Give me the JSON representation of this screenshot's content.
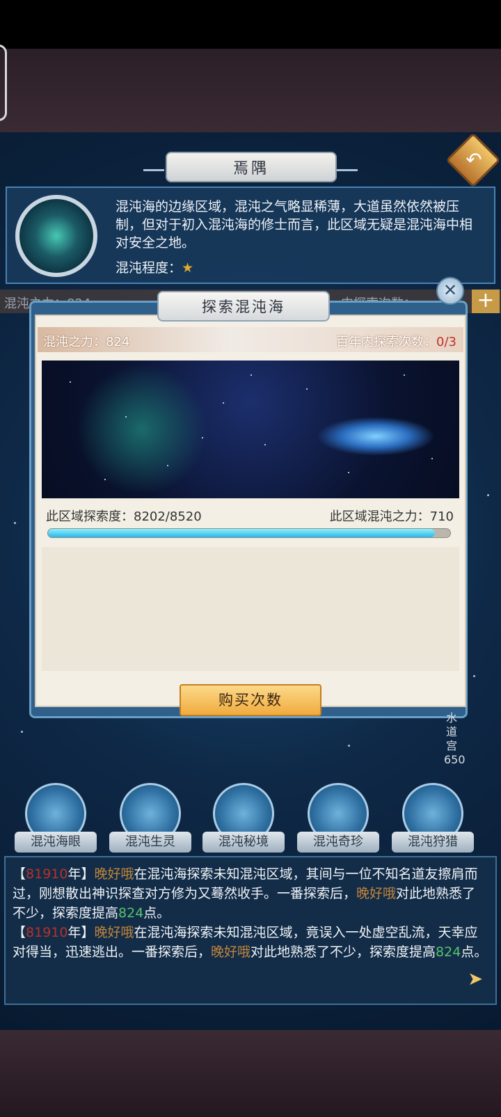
{
  "header": {
    "title": "焉隅"
  },
  "info": {
    "description": "混沌海的边缘区域，混沌之气略显稀薄，大道虽然依然被压制，但对于初入混沌海的修士而言，此区域无疑是混沌海中相对安全之地。",
    "chaos_level_label": "混沌程度：",
    "chaos_level_stars": 1
  },
  "underlay": {
    "left_text": "混沌之力：824",
    "right_text": "内探索次数："
  },
  "modal": {
    "title": "探索混沌海",
    "chaos_power": "混沌之力：824",
    "explore_count_label": "百年内探索次数：",
    "explore_count_value": "0/3",
    "region_progress": "此区域探索度：8202/8520",
    "region_chaos": "此区域混沌之力：710",
    "progress_fraction": 0.9627,
    "buy_button": "购买次数"
  },
  "side_vertical_text": "水道宫650",
  "nav": [
    {
      "label": "混沌海眼"
    },
    {
      "label": "混沌生灵"
    },
    {
      "label": "混沌秘境"
    },
    {
      "label": "混沌奇珍"
    },
    {
      "label": "混沌狩猎"
    }
  ],
  "log": {
    "entry1": {
      "open": "【",
      "year": "81910",
      "year_suffix": "年】",
      "name": "晚好哦",
      "text1": "在混沌海探索未知混沌区域，其间与一位不知名道友擦肩而过，刚想散出神识探查对方修为又蓦然收手。一番探索后，",
      "name2": "晚好哦",
      "text2": "对此地熟悉了不少，探索度提高",
      "points": "824",
      "text3": "点。"
    },
    "entry2": {
      "open": "【",
      "year": "81910",
      "year_suffix": "年】",
      "name": "晚好哦",
      "text1": "在混沌海探索未知混沌区域，竟误入一处虚空乱流，天幸应对得当，迅速逃出。一番探索后，",
      "name2": "晚好哦",
      "text2": "对此地熟悉了不少，探索度提高",
      "points": "824",
      "text3": "点。"
    }
  },
  "colors": {
    "accent_gold": "#f0ab3e",
    "progress_blue": "#2bb7e8",
    "count_red": "#c0302a",
    "name_orange": "#c2853a",
    "points_green": "#55c56b"
  },
  "icons": [
    "back-arrow-icon",
    "star-icon",
    "close-icon",
    "plus-icon",
    "next-arrow-icon"
  ]
}
